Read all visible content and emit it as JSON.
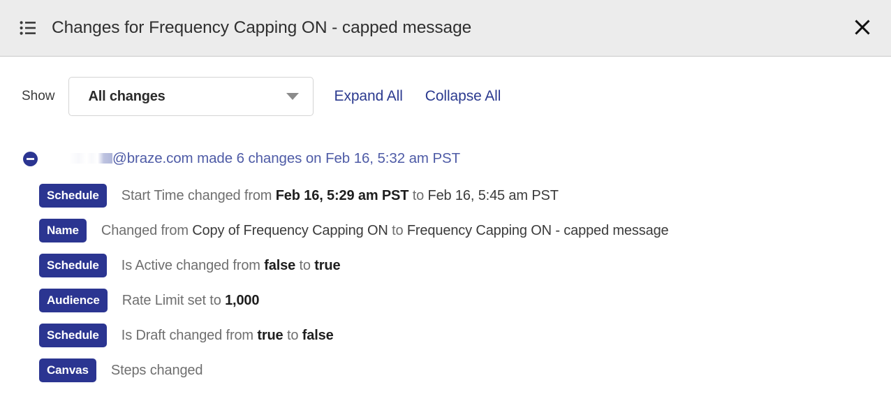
{
  "header": {
    "title": "Changes for Frequency Capping ON - capped message",
    "list_icon": "bulleted-list-icon",
    "close_icon": "close-icon"
  },
  "controls": {
    "show_label": "Show",
    "filter_value": "All changes",
    "filter_options": [
      "All changes"
    ],
    "expand_all": "Expand All",
    "collapse_all": "Collapse All"
  },
  "group": {
    "toggle_icon": "minus-circle-icon",
    "toggle_state": "expanded",
    "title_suffix": "@braze.com made 6 changes on Feb 16, 5:32 am PST",
    "author_redacted": true,
    "change_count": 6,
    "timestamp": "Feb 16, 5:32 am PST"
  },
  "changes": [
    {
      "badge": "Schedule",
      "parts": [
        {
          "text": "Start Time changed from ",
          "style": "muted"
        },
        {
          "text": "Feb 16, 5:29 am PST",
          "style": "bold"
        },
        {
          "text": " to ",
          "style": "muted"
        },
        {
          "text": "Feb 16, 5:45 am PST",
          "style": "plain"
        }
      ]
    },
    {
      "badge": "Name",
      "parts": [
        {
          "text": "Changed from ",
          "style": "muted"
        },
        {
          "text": "Copy of Frequency Capping ON",
          "style": "plain"
        },
        {
          "text": " to ",
          "style": "muted"
        },
        {
          "text": "Frequency Capping ON - capped message",
          "style": "plain"
        }
      ]
    },
    {
      "badge": "Schedule",
      "parts": [
        {
          "text": "Is Active changed from ",
          "style": "muted"
        },
        {
          "text": "false",
          "style": "bold"
        },
        {
          "text": " to ",
          "style": "muted"
        },
        {
          "text": "true",
          "style": "bold"
        }
      ]
    },
    {
      "badge": "Audience",
      "parts": [
        {
          "text": "Rate Limit set to ",
          "style": "muted"
        },
        {
          "text": "1,000",
          "style": "bold"
        }
      ]
    },
    {
      "badge": "Schedule",
      "parts": [
        {
          "text": "Is Draft changed from ",
          "style": "muted"
        },
        {
          "text": "true",
          "style": "bold"
        },
        {
          "text": " to ",
          "style": "muted"
        },
        {
          "text": "false",
          "style": "bold"
        }
      ]
    },
    {
      "badge": "Canvas",
      "parts": [
        {
          "text": "Steps changed",
          "style": "muted"
        }
      ]
    }
  ],
  "colors": {
    "badge_bg": "#2b3591",
    "link": "#2b3a8f",
    "group_title": "#4e5ba6",
    "header_bg": "#ececec"
  }
}
